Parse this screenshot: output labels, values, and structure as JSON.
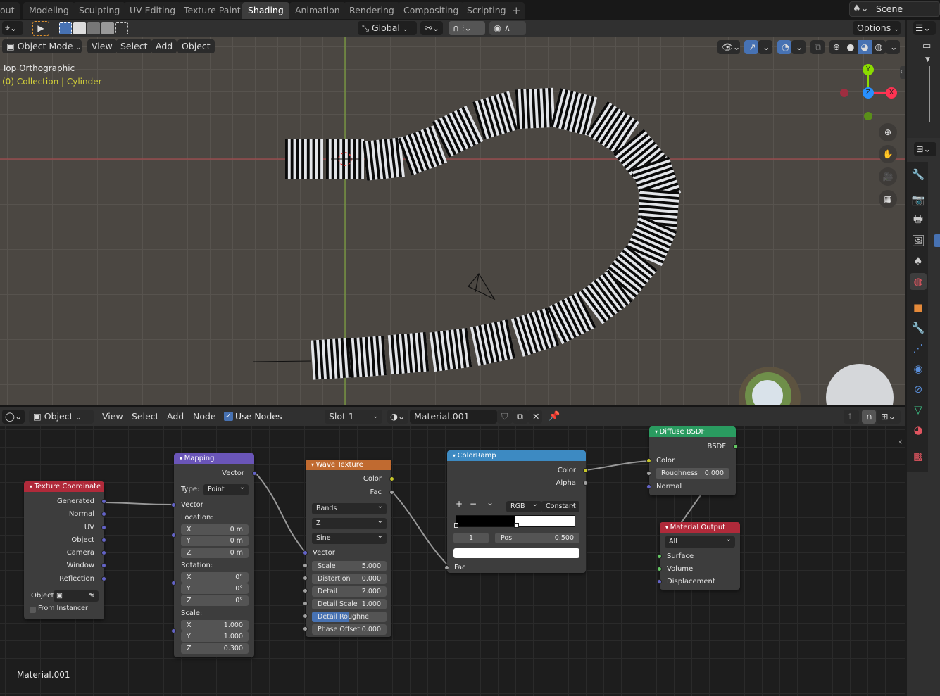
{
  "workspace_tabs": [
    {
      "label": "out",
      "active": false
    },
    {
      "label": "Modeling",
      "active": false
    },
    {
      "label": "Sculpting",
      "active": false
    },
    {
      "label": "UV Editing",
      "active": false
    },
    {
      "label": "Texture Paint",
      "active": false
    },
    {
      "label": "Shading",
      "active": true
    },
    {
      "label": "Animation",
      "active": false
    },
    {
      "label": "Rendering",
      "active": false
    },
    {
      "label": "Compositing",
      "active": false
    },
    {
      "label": "Scripting",
      "active": false
    }
  ],
  "add_workspace": "+",
  "scene": {
    "name": "Scene"
  },
  "tool_header": {
    "transform_orientation": "Global",
    "options_label": "Options"
  },
  "viewport": {
    "mode": "Object Mode",
    "menus": [
      "View",
      "Select",
      "Add",
      "Object"
    ],
    "view_name": "Top Orthographic",
    "collection_info": "(0) Collection | Cylinder",
    "gizmo": {
      "x": "X",
      "y": "Y",
      "z": "Z"
    },
    "colors": {
      "x_axis": "#ff3352",
      "y_axis": "#8bdc00",
      "z_axis": "#2890ff",
      "stripe_dark": "#0a0a0a",
      "stripe_light": "#e2e4e8"
    }
  },
  "node_editor": {
    "type": "Object",
    "menus": [
      "View",
      "Select",
      "Add",
      "Node"
    ],
    "use_nodes_label": "Use Nodes",
    "use_nodes": true,
    "slot": "Slot 1",
    "material": "Material.001",
    "footer_material": "Material.001"
  },
  "nodes": {
    "texcoord": {
      "title": "Texture Coordinate",
      "outputs": [
        "Generated",
        "Normal",
        "UV",
        "Object",
        "Camera",
        "Window",
        "Reflection"
      ],
      "object_label": "Object:",
      "from_instancer": "From Instancer"
    },
    "mapping": {
      "title": "Mapping",
      "output": "Vector",
      "type_label": "Type:",
      "type_value": "Point",
      "input": "Vector",
      "location_label": "Location:",
      "location": [
        {
          "k": "X",
          "v": "0 m"
        },
        {
          "k": "Y",
          "v": "0 m"
        },
        {
          "k": "Z",
          "v": "0 m"
        }
      ],
      "rotation_label": "Rotation:",
      "rotation": [
        {
          "k": "X",
          "v": "0°"
        },
        {
          "k": "Y",
          "v": "0°"
        },
        {
          "k": "Z",
          "v": "0°"
        }
      ],
      "scale_label": "Scale:",
      "scale": [
        {
          "k": "X",
          "v": "1.000"
        },
        {
          "k": "Y",
          "v": "1.000"
        },
        {
          "k": "Z",
          "v": "0.300"
        }
      ]
    },
    "wave": {
      "title": "Wave Texture",
      "outputs": [
        "Color",
        "Fac"
      ],
      "wave_type": "Bands",
      "direction": "Z",
      "profile": "Sine",
      "input": "Vector",
      "params": [
        {
          "k": "Scale",
          "v": "5.000"
        },
        {
          "k": "Distortion",
          "v": "0.000"
        },
        {
          "k": "Detail",
          "v": "2.000"
        },
        {
          "k": "Detail Scale",
          "v": "1.000"
        },
        {
          "k": "Detail Roughne",
          "v": "0.500",
          "fill": 0.5
        },
        {
          "k": "Phase Offset",
          "v": "0.000"
        }
      ]
    },
    "colorramp": {
      "title": "ColorRamp",
      "outputs": [
        "Color",
        "Alpha"
      ],
      "add": "+",
      "remove": "−",
      "menu": "⌄",
      "color_mode": "RGB",
      "interpolation": "Constant",
      "stop_index": "1",
      "pos_label": "Pos",
      "pos_value": "0.500",
      "input": "Fac",
      "stops": [
        {
          "pos": 0.0,
          "color": "#000000"
        },
        {
          "pos": 0.5,
          "color": "#ffffff"
        }
      ]
    },
    "diffuse": {
      "title": "Diffuse BSDF",
      "output": "BSDF",
      "inputs": [
        "Color",
        "Normal"
      ],
      "roughness_label": "Roughness",
      "roughness": "0.000"
    },
    "output": {
      "title": "Material Output",
      "target": "All",
      "inputs": [
        "Surface",
        "Volume",
        "Displacement"
      ]
    }
  },
  "node_colors": {
    "texcoord": "#b02a3a",
    "mapping": "#6a55b8",
    "wave": "#c06a30",
    "colorramp": "#3d8ac2",
    "diffuse": "#2a9b60",
    "output": "#b02a3a"
  }
}
